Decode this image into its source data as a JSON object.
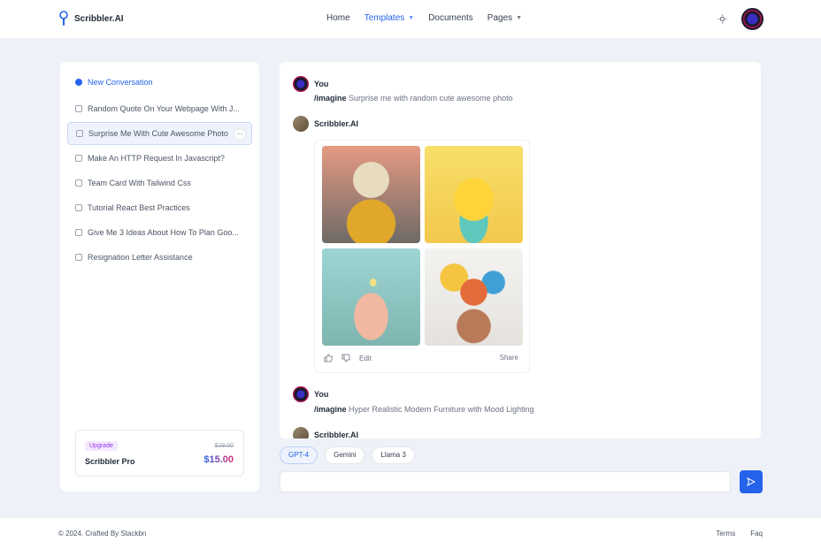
{
  "brand": {
    "name": "Scribbler.AI"
  },
  "nav": {
    "items": [
      {
        "label": "Home",
        "has_caret": false,
        "active": false
      },
      {
        "label": "Templates",
        "has_caret": true,
        "active": true
      },
      {
        "label": "Documents",
        "has_caret": false,
        "active": false
      },
      {
        "label": "Pages",
        "has_caret": true,
        "active": false
      }
    ]
  },
  "sidebar": {
    "new_conversation": "New Conversation",
    "items": [
      "Random Quote On Your Webpage With J...",
      "Surprise Me With Cute Awesome Photo",
      "Make An HTTP Request In Javascript?",
      "Team Card With Tailwind Css",
      "Tutorial React Best Practices",
      "Give Me 3 Ideas About How To Plan Goo...",
      "Resignation Letter Assistance"
    ],
    "selected_index": 1,
    "more_glyph": "···"
  },
  "upgrade": {
    "badge": "Upgrade",
    "plan": "Scribbler Pro",
    "old_price": "$29.00",
    "price": "$15.00"
  },
  "chat": {
    "messages": [
      {
        "author": "You",
        "command": "/imagine",
        "text": "Surprise me with random cute awesome photo"
      },
      {
        "author": "Scribbler.AI"
      },
      {
        "author": "You",
        "command": "/imagine",
        "text": "Hyper Realistic Modern Furniture with Mood Lighting"
      },
      {
        "author": "Scribbler.AI"
      }
    ],
    "image_actions": {
      "edit": "Edit",
      "share": "Share"
    }
  },
  "models": [
    "GPT-4",
    "Gemini",
    "Llama 3"
  ],
  "active_model": "GPT-4",
  "prompt": {
    "value": "",
    "placeholder": ""
  },
  "footer": {
    "copyright": "© 2024. Crafted By Stackbn",
    "links": [
      "Terms",
      "Faq"
    ]
  },
  "colors": {
    "accent": "#2563eb",
    "price_gradient_end": "#db2777",
    "badge": "#9333ea"
  }
}
